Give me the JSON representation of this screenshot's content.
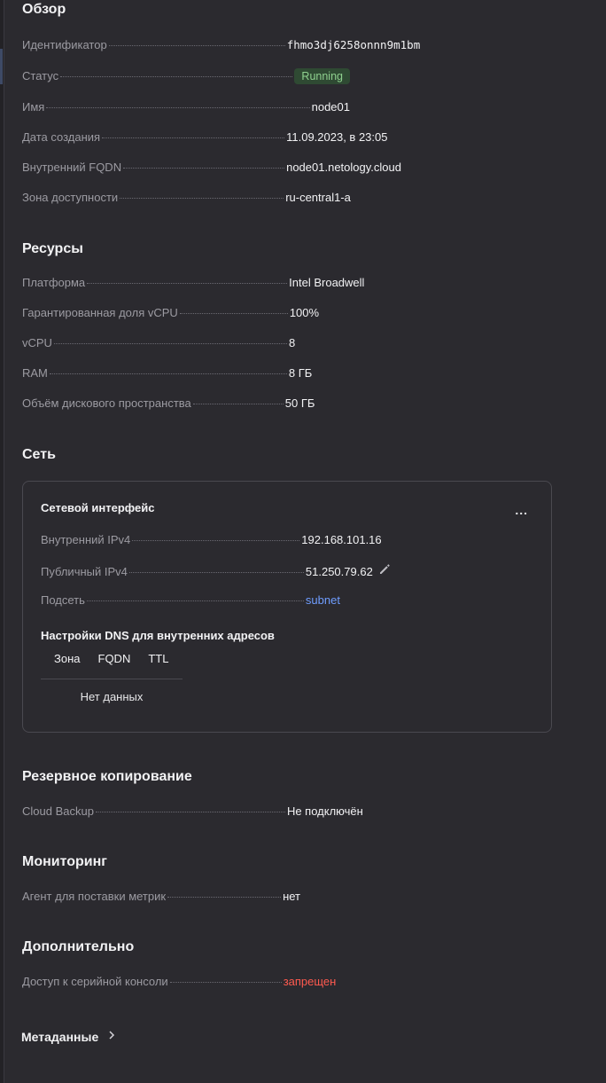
{
  "overview": {
    "title": "Обзор",
    "rows": [
      {
        "label": "Идентификатор",
        "value": "fhmo3dj6258onnn9m1bm"
      },
      {
        "label": "Статус",
        "value": "Running"
      },
      {
        "label": "Имя",
        "value": "node01"
      },
      {
        "label": "Дата создания",
        "value": "11.09.2023, в 23:05"
      },
      {
        "label": "Внутренний FQDN",
        "value": "node01.netology.cloud"
      },
      {
        "label": "Зона доступности",
        "value": "ru-central1-a"
      }
    ]
  },
  "resources": {
    "title": "Ресурсы",
    "rows": [
      {
        "label": "Платформа",
        "value": "Intel Broadwell"
      },
      {
        "label": "Гарантированная доля vCPU",
        "value": "100%"
      },
      {
        "label": "vCPU",
        "value": "8"
      },
      {
        "label": "RAM",
        "value": "8 ГБ"
      },
      {
        "label": "Объём дискового пространства",
        "value": "50 ГБ"
      }
    ]
  },
  "network": {
    "title": "Сеть",
    "card_title": "Сетевой интерфейс",
    "more_label": "...",
    "rows": [
      {
        "label": "Внутренний IPv4",
        "value": "192.168.101.16"
      },
      {
        "label": "Публичный IPv4",
        "value": "51.250.79.62"
      },
      {
        "label": "Подсеть",
        "value": "subnet"
      }
    ],
    "dns": {
      "title": "Настройки DNS для внутренних адресов",
      "columns": [
        "Зона",
        "FQDN",
        "TTL"
      ],
      "empty_text": "Нет данных"
    }
  },
  "backup": {
    "title": "Резервное копирование",
    "rows": [
      {
        "label": "Cloud Backup",
        "value": "Не подключён"
      }
    ]
  },
  "monitoring": {
    "title": "Мониторинг",
    "rows": [
      {
        "label": "Агент для поставки метрик",
        "value": "нет"
      }
    ]
  },
  "additional": {
    "title": "Дополнительно",
    "rows": [
      {
        "label": "Доступ к серийной консоли",
        "value": "запрещен"
      }
    ]
  },
  "metadata": {
    "label": "Метаданные"
  },
  "colors": {
    "background": "#2b2a2f",
    "status_badge_bg": "#2f4a33",
    "status_badge_text": "#8fd18f",
    "link": "#6f9dff",
    "danger": "#ff5a4f"
  },
  "icons": {
    "edit": "pencil-icon",
    "more": "more-horizontal-icon",
    "chevron": "chevron-right-icon"
  }
}
